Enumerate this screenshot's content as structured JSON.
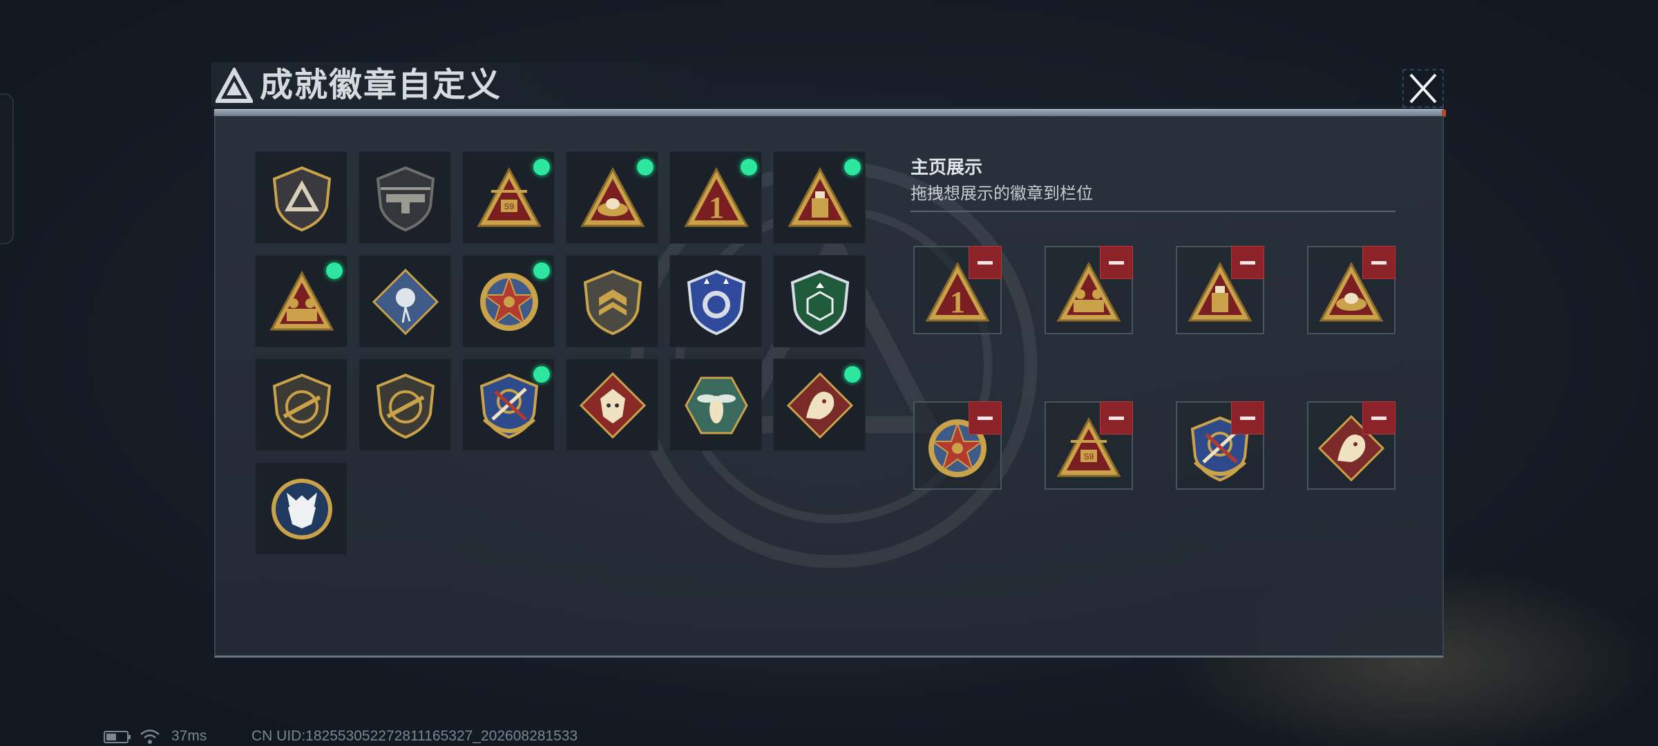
{
  "header": {
    "title": "成就徽章自定义",
    "close_icon": "close-icon"
  },
  "colors": {
    "accent_green": "#2ee6a0",
    "remove_red": "#8c2328",
    "gold": "#c9a24a",
    "panel_bg": "#2a323c"
  },
  "badge_grid": [
    {
      "icon": "shield-triangle-logo-badge",
      "new": false
    },
    {
      "icon": "helicopter-shield-badge",
      "new": false
    },
    {
      "icon": "triangle-s9-helicopter-badge",
      "new": true
    },
    {
      "icon": "triangle-egg-nest-badge",
      "new": true
    },
    {
      "icon": "triangle-number-one-badge",
      "new": true
    },
    {
      "icon": "triangle-usb-drive-badge",
      "new": true
    },
    {
      "icon": "triangle-soldiers-badge",
      "new": true
    },
    {
      "icon": "diamond-rose-badge",
      "new": false
    },
    {
      "icon": "star-medal-badge",
      "new": true
    },
    {
      "icon": "shield-chevron-badge",
      "new": false
    },
    {
      "icon": "blue-shield-star-badge",
      "new": false
    },
    {
      "icon": "green-shield-dice-badge",
      "new": false
    },
    {
      "icon": "shield-rifle-badge",
      "new": false
    },
    {
      "icon": "shield-rifle-badge-2",
      "new": false
    },
    {
      "icon": "blue-shield-swords-badge",
      "new": true
    },
    {
      "icon": "diamond-wolf-badge",
      "new": false
    },
    {
      "icon": "hexagon-wasp-badge",
      "new": false
    },
    {
      "icon": "diamond-dragon-badge",
      "new": true
    },
    {
      "icon": "round-lynx-badge",
      "new": false
    }
  ],
  "showcase": {
    "title": "主页展示",
    "subtitle": "拖拽想展示的徽章到栏位",
    "remove_icon": "minus-icon",
    "slots": [
      {
        "icon": "triangle-number-one-badge"
      },
      {
        "icon": "triangle-soldiers-badge"
      },
      {
        "icon": "triangle-usb-drive-badge"
      },
      {
        "icon": "triangle-egg-nest-badge"
      },
      {
        "icon": "star-medal-badge"
      },
      {
        "icon": "triangle-s9-helicopter-badge"
      },
      {
        "icon": "blue-shield-swords-badge"
      },
      {
        "icon": "diamond-dragon-badge"
      }
    ]
  },
  "footer": {
    "battery_icon": "battery-icon",
    "wifi_icon": "wifi-icon",
    "ping": "37ms",
    "uid": "CN UID:18255305227281116532​7_202608281533"
  }
}
